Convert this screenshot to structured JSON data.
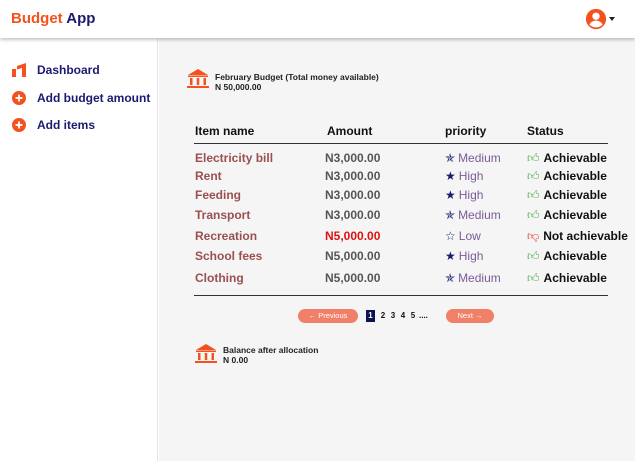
{
  "app": {
    "brand_primary": "Budget",
    "brand_secondary": "App",
    "brand_primary_color": "#f4511e",
    "brand_secondary_color": "#1a1a6e"
  },
  "header": {
    "account_icon": "account-circle-icon",
    "menu_icon": "caret-down-icon"
  },
  "sidebar": {
    "items": [
      {
        "label": "Dashboard",
        "icon": "dashboard-icon"
      },
      {
        "label": "Add budget amount",
        "icon": "plus-circle-icon"
      },
      {
        "label": "Add items",
        "icon": "plus-circle-icon"
      }
    ]
  },
  "budget": {
    "title": "February Budget (Total money available)",
    "amount": "N 50,000.00",
    "icon": "bank-icon"
  },
  "table": {
    "columns": [
      "Item name",
      "Amount",
      "priority",
      "Status"
    ],
    "rows": [
      {
        "name": "Electricity bill",
        "amount": "N3,000.00",
        "priority": "Medium",
        "priority_icon": "star-half",
        "status": "Achievable",
        "status_type": "good"
      },
      {
        "name": "Rent",
        "amount": "N3,000.00",
        "priority": "High",
        "priority_icon": "star-filled",
        "status": "Achievable",
        "status_type": "good"
      },
      {
        "name": "Feeding",
        "amount": "N3,000.00",
        "priority": "High",
        "priority_icon": "star-filled",
        "status": "Achievable",
        "status_type": "good"
      },
      {
        "name": "Transport",
        "amount": "N3,000.00",
        "priority": "Medium",
        "priority_icon": "star-half",
        "status": "Achievable",
        "status_type": "good"
      },
      {
        "name": "Recreation",
        "amount": "N5,000.00",
        "priority": "Low",
        "priority_icon": "star-outline",
        "status": "Not achievable",
        "status_type": "bad",
        "amount_alert": true
      },
      {
        "name": "School fees",
        "amount": "N5,000.00",
        "priority": "High",
        "priority_icon": "star-filled",
        "status": "Achievable",
        "status_type": "good"
      },
      {
        "name": "Clothing",
        "amount": "N5,000.00",
        "priority": "Medium",
        "priority_icon": "star-half",
        "status": "Achievable",
        "status_type": "good"
      }
    ]
  },
  "pagination": {
    "previous": "← Previous",
    "next": "Next →",
    "pages": [
      "1",
      "2",
      "3",
      "4",
      "5"
    ],
    "current": "1",
    "ellipsis": "...."
  },
  "balance": {
    "title": "Balance after allocation",
    "amount": "N 0.00",
    "icon": "bank-icon"
  },
  "colors": {
    "accent": "#f4511e",
    "navy": "#1a1a6e",
    "good": "#4caf50",
    "bad": "#e53935",
    "alert_text": "#e01010",
    "pager_button": "#f08068"
  }
}
